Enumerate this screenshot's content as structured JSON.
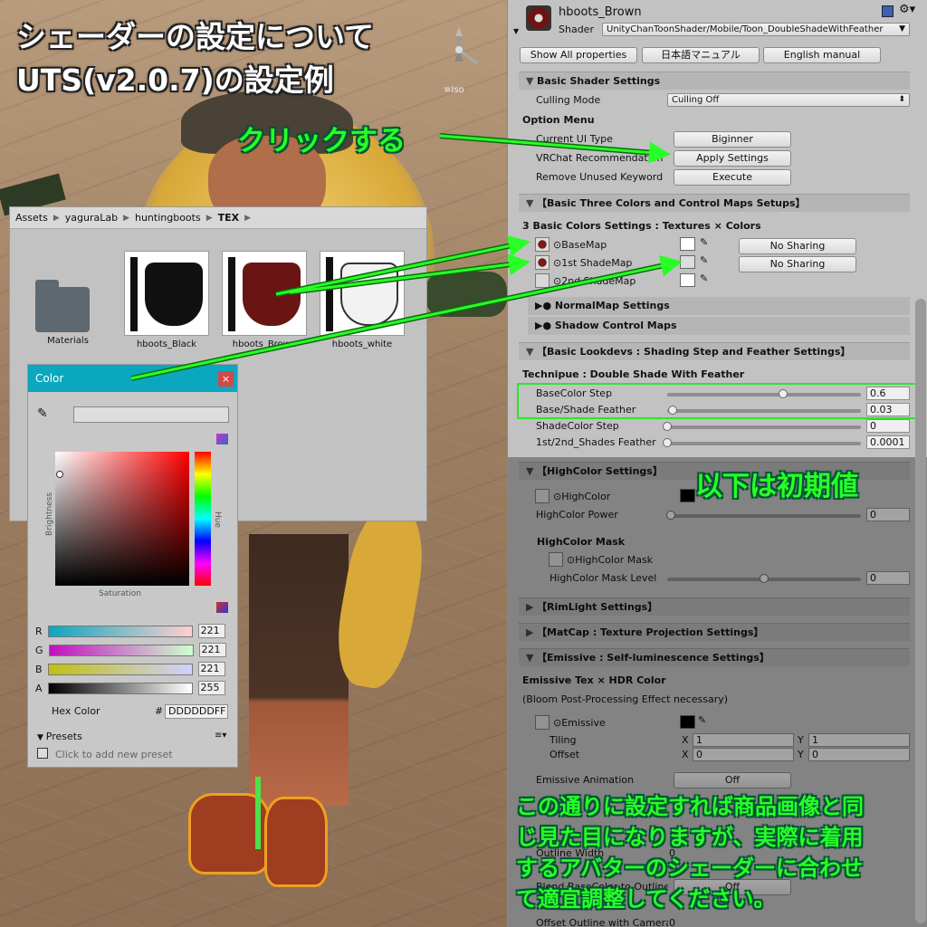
{
  "overlay": {
    "title_line1": "シェーダーの設定について",
    "title_line2": "UTS(v2.0.7)の設定例",
    "click_note": "クリックする",
    "defaults_note": "以下は初期値",
    "bottom_note_lines": [
      "この通りに設定すれば商品画像と同",
      "じ見た目になりますが、実際に着用",
      "するアバターのシェーダーに合わせ",
      "て適宜調整してください。"
    ],
    "gizmo_label": "≡Iso",
    "accent_color": "#27ff27"
  },
  "project": {
    "breadcrumbs": [
      "Assets",
      "yaguraLab",
      "huntingboots",
      "TEX"
    ],
    "assets": [
      {
        "label": "Materials",
        "color": "#5e6870"
      },
      {
        "label": "hboots_Black",
        "color": "#111111"
      },
      {
        "label": "hboots_Brown",
        "color": "#6b1414"
      },
      {
        "label": "hboots_white",
        "color": "#f2f2f2"
      }
    ]
  },
  "color_picker": {
    "title": "Color",
    "close_label": "×",
    "brightness_label": "Brightness",
    "saturation_label": "Saturation",
    "hue_label": "Hue",
    "channels": [
      {
        "name": "R",
        "value": "221"
      },
      {
        "name": "G",
        "value": "221"
      },
      {
        "name": "B",
        "value": "221"
      },
      {
        "name": "A",
        "value": "255"
      }
    ],
    "hex_label": "Hex Color",
    "hex_hash": "#",
    "hex_value": "DDDDDDFF",
    "presets_label": "Presets",
    "presets_hint": "Click to add new preset"
  },
  "inspector": {
    "material_name": "hboots_Brown",
    "shader_label": "Shader",
    "shader_value": "UnityChanToonShader/Mobile/Toon_DoubleShadeWithFeather",
    "btn_show_all": "Show All properties",
    "btn_jp_manual": "日本語マニュアル",
    "btn_en_manual": "English manual",
    "sec_basic_shader": "Basic Shader Settings",
    "culling_label": "Culling Mode",
    "culling_value": "Culling Off",
    "option_menu": "Option Menu",
    "ui_type_label": "Current UI Type",
    "ui_type_value": "Biginner",
    "vrchat_label": "VRChat Recommendation",
    "vrchat_button": "Apply Settings",
    "remove_kw_label": "Remove Unused Keyword",
    "remove_kw_button": "Execute",
    "sec_three_colors": "【Basic Three Colors and Control Maps Setups】",
    "three_colors_sub": "3 Basic Colors Settings : Textures × Colors",
    "base_map": "BaseMap",
    "shade1_map": "1st ShadeMap",
    "shade2_map": "2nd ShadeMap",
    "no_sharing": "No Sharing",
    "normal_map": "● NormalMap Settings",
    "shadow_maps": "● Shadow Control Maps",
    "sec_lookdevs": "【Basic Lookdevs : Shading Step and Feather Settings】",
    "technique": "Technipue : Double Shade With Feather",
    "sliders": [
      {
        "label": "BaseColor Step",
        "value": "0.6",
        "level": 0.6
      },
      {
        "label": "Base/Shade Feather",
        "value": "0.03",
        "level": 0.03
      },
      {
        "label": "ShadeColor Step",
        "value": "0",
        "level": 0
      },
      {
        "label": "1st/2nd_Shades Feather",
        "value": "0.0001",
        "level": 0
      }
    ],
    "sec_highcolor": "【HighColor Settings】",
    "highcolor": "HighColor",
    "highcolor_power": "HighColor Power",
    "highcolor_power_value": "0",
    "highcolor_mask_title": "HighColor Mask",
    "highcolor_mask": "HighColor Mask",
    "highcolor_mask_level": "HighColor Mask Level",
    "highcolor_mask_level_value": "0",
    "highcolor_mask_level_level": 0.5,
    "sec_rimlight": "【RimLight Settings】",
    "sec_matcap": "【MatCap : Texture Projection Settings】",
    "sec_emissive": "【Emissive : Self-luminescence Settings】",
    "emissive_title": "Emissive Tex × HDR Color",
    "emissive_note": "(Bloom Post-Processing Effect necessary)",
    "emissive": "Emissive",
    "tiling": "Tiling",
    "offset": "Offset",
    "x_label": "X",
    "y_label": "Y",
    "tiling_x": "1",
    "tiling_y": "1",
    "offset_x": "0",
    "offset_y": "0",
    "emissive_anim": "Emissive Animation",
    "emissive_anim_value": "Off",
    "outline_width": "Outline Width",
    "outline_width_value": "0",
    "blend_base": "Blend BaseColor to Outline",
    "blend_base_value": "Off",
    "offset_outline": "Offset Outline with Camera Z-axis",
    "offset_outline_value": "0"
  }
}
